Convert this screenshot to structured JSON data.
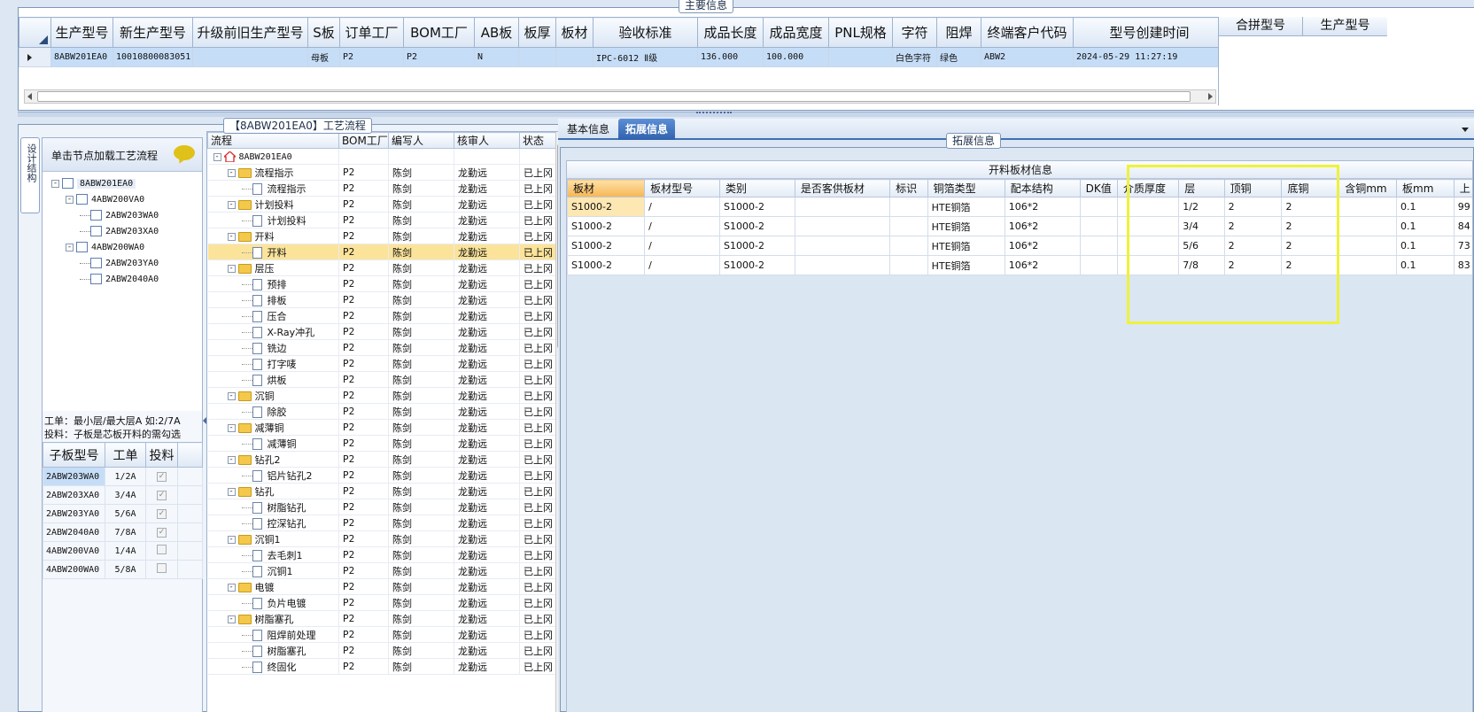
{
  "main_info": {
    "title": "主要信息",
    "columns": [
      "生产型号",
      "新生产型号",
      "升级前旧生产型号",
      "S板",
      "订单工厂",
      "BOM工厂",
      "AB板",
      "板厚",
      "板材",
      "验收标准",
      "成品长度",
      "成品宽度",
      "PNL规格",
      "字符",
      "阻焊",
      "终端客户代码",
      "型号创建时间"
    ],
    "rows": [
      [
        "8ABW201EA0",
        "10010800083051",
        "",
        "母板",
        "P2",
        "P2",
        "N",
        "",
        "",
        "IPC-6012 Ⅱ级",
        "136.000",
        "100.000",
        "",
        "白色字符",
        "绿色",
        "ABW2",
        "2024-05-29 11:27:19"
      ]
    ],
    "side_columns": [
      "合拼型号",
      "生产型号"
    ]
  },
  "process_panel": {
    "title": "【8ABW201EA0】工艺流程",
    "vertical_tab": "设计结构",
    "hint": "单击节点加载工艺流程",
    "tree": [
      {
        "label": "8ABW201EA0",
        "level": 0,
        "expander": "-"
      },
      {
        "label": "4ABW200VA0",
        "level": 1,
        "expander": "-"
      },
      {
        "label": "2ABW203WA0",
        "level": 2,
        "expander": ""
      },
      {
        "label": "2ABW203XA0",
        "level": 2,
        "expander": ""
      },
      {
        "label": "4ABW200WA0",
        "level": 1,
        "expander": "-"
      },
      {
        "label": "2ABW203YA0",
        "level": 2,
        "expander": ""
      },
      {
        "label": "2ABW2040A0",
        "level": 2,
        "expander": ""
      }
    ],
    "notes": [
      "工单：最小层/最大层A 如:2/7A",
      "投料：子板是芯板开料的需勾选"
    ],
    "sub_columns": [
      "子板型号",
      "工单",
      "投料"
    ],
    "sub_rows": [
      {
        "model": "2ABW203WA0",
        "order": "1/2A",
        "checked": true
      },
      {
        "model": "2ABW203XA0",
        "order": "3/4A",
        "checked": true
      },
      {
        "model": "2ABW203YA0",
        "order": "5/6A",
        "checked": true
      },
      {
        "model": "2ABW2040A0",
        "order": "7/8A",
        "checked": true
      },
      {
        "model": "4ABW200VA0",
        "order": "1/4A",
        "checked": false
      },
      {
        "model": "4ABW200WA0",
        "order": "5/8A",
        "checked": false
      }
    ],
    "check_glyph": "✓",
    "flow_columns": [
      "流程",
      "BOM工厂",
      "编写人",
      "核审人",
      "状态"
    ],
    "flow_rows": [
      {
        "label": "8ABW201EA0",
        "type": "root",
        "level": 0,
        "bom": "",
        "writer": "",
        "reviewer": "",
        "status": ""
      },
      {
        "label": "流程指示",
        "type": "folder",
        "level": 1,
        "bom": "P2",
        "writer": "陈剑",
        "reviewer": "龙勤远",
        "status": "已上冈"
      },
      {
        "label": "流程指示",
        "type": "doc",
        "level": 2,
        "bom": "P2",
        "writer": "陈剑",
        "reviewer": "龙勤远",
        "status": "已上冈"
      },
      {
        "label": "计划投料",
        "type": "folder",
        "level": 1,
        "bom": "P2",
        "writer": "陈剑",
        "reviewer": "龙勤远",
        "status": "已上冈"
      },
      {
        "label": "计划投料",
        "type": "doc",
        "level": 2,
        "bom": "P2",
        "writer": "陈剑",
        "reviewer": "龙勤远",
        "status": "已上冈"
      },
      {
        "label": "开料",
        "type": "folder",
        "level": 1,
        "bom": "P2",
        "writer": "陈剑",
        "reviewer": "龙勤远",
        "status": "已上冈"
      },
      {
        "label": "开料",
        "type": "doc",
        "level": 2,
        "bom": "P2",
        "writer": "陈剑",
        "reviewer": "龙勤远",
        "status": "已上冈",
        "selected": true
      },
      {
        "label": "层压",
        "type": "folder",
        "level": 1,
        "bom": "P2",
        "writer": "陈剑",
        "reviewer": "龙勤远",
        "status": "已上冈"
      },
      {
        "label": "预排",
        "type": "doc",
        "level": 2,
        "bom": "P2",
        "writer": "陈剑",
        "reviewer": "龙勤远",
        "status": "已上冈"
      },
      {
        "label": "排板",
        "type": "doc",
        "level": 2,
        "bom": "P2",
        "writer": "陈剑",
        "reviewer": "龙勤远",
        "status": "已上冈"
      },
      {
        "label": "压合",
        "type": "doc",
        "level": 2,
        "bom": "P2",
        "writer": "陈剑",
        "reviewer": "龙勤远",
        "status": "已上冈"
      },
      {
        "label": "X-Ray冲孔",
        "type": "doc",
        "level": 2,
        "bom": "P2",
        "writer": "陈剑",
        "reviewer": "龙勤远",
        "status": "已上冈"
      },
      {
        "label": "铣边",
        "type": "doc",
        "level": 2,
        "bom": "P2",
        "writer": "陈剑",
        "reviewer": "龙勤远",
        "status": "已上冈"
      },
      {
        "label": "打字唛",
        "type": "doc",
        "level": 2,
        "bom": "P2",
        "writer": "陈剑",
        "reviewer": "龙勤远",
        "status": "已上冈"
      },
      {
        "label": "烘板",
        "type": "doc",
        "level": 2,
        "bom": "P2",
        "writer": "陈剑",
        "reviewer": "龙勤远",
        "status": "已上冈"
      },
      {
        "label": "沉铜",
        "type": "folder",
        "level": 1,
        "bom": "P2",
        "writer": "陈剑",
        "reviewer": "龙勤远",
        "status": "已上冈"
      },
      {
        "label": "除胶",
        "type": "doc",
        "level": 2,
        "bom": "P2",
        "writer": "陈剑",
        "reviewer": "龙勤远",
        "status": "已上冈"
      },
      {
        "label": "减薄铜",
        "type": "folder",
        "level": 1,
        "bom": "P2",
        "writer": "陈剑",
        "reviewer": "龙勤远",
        "status": "已上冈"
      },
      {
        "label": "减薄铜",
        "type": "doc",
        "level": 2,
        "bom": "P2",
        "writer": "陈剑",
        "reviewer": "龙勤远",
        "status": "已上冈"
      },
      {
        "label": "钻孔2",
        "type": "folder",
        "level": 1,
        "bom": "P2",
        "writer": "陈剑",
        "reviewer": "龙勤远",
        "status": "已上冈"
      },
      {
        "label": "铝片钻孔2",
        "type": "doc",
        "level": 2,
        "bom": "P2",
        "writer": "陈剑",
        "reviewer": "龙勤远",
        "status": "已上冈"
      },
      {
        "label": "钻孔",
        "type": "folder",
        "level": 1,
        "bom": "P2",
        "writer": "陈剑",
        "reviewer": "龙勤远",
        "status": "已上冈"
      },
      {
        "label": "树脂钻孔",
        "type": "doc",
        "level": 2,
        "bom": "P2",
        "writer": "陈剑",
        "reviewer": "龙勤远",
        "status": "已上冈"
      },
      {
        "label": "控深钻孔",
        "type": "doc",
        "level": 2,
        "bom": "P2",
        "writer": "陈剑",
        "reviewer": "龙勤远",
        "status": "已上冈"
      },
      {
        "label": "沉铜1",
        "type": "folder",
        "level": 1,
        "bom": "P2",
        "writer": "陈剑",
        "reviewer": "龙勤远",
        "status": "已上冈"
      },
      {
        "label": "去毛刺1",
        "type": "doc",
        "level": 2,
        "bom": "P2",
        "writer": "陈剑",
        "reviewer": "龙勤远",
        "status": "已上冈"
      },
      {
        "label": "沉铜1",
        "type": "doc",
        "level": 2,
        "bom": "P2",
        "writer": "陈剑",
        "reviewer": "龙勤远",
        "status": "已上冈"
      },
      {
        "label": "电镀",
        "type": "folder",
        "level": 1,
        "bom": "P2",
        "writer": "陈剑",
        "reviewer": "龙勤远",
        "status": "已上冈"
      },
      {
        "label": "负片电镀",
        "type": "doc",
        "level": 2,
        "bom": "P2",
        "writer": "陈剑",
        "reviewer": "龙勤远",
        "status": "已上冈"
      },
      {
        "label": "树脂塞孔",
        "type": "folder",
        "level": 1,
        "bom": "P2",
        "writer": "陈剑",
        "reviewer": "龙勤远",
        "status": "已上冈"
      },
      {
        "label": "阻焊前处理",
        "type": "doc",
        "level": 2,
        "bom": "P2",
        "writer": "陈剑",
        "reviewer": "龙勤远",
        "status": "已上冈"
      },
      {
        "label": "树脂塞孔",
        "type": "doc",
        "level": 2,
        "bom": "P2",
        "writer": "陈剑",
        "reviewer": "龙勤远",
        "status": "已上冈"
      },
      {
        "label": "终固化",
        "type": "doc",
        "level": 2,
        "bom": "P2",
        "writer": "陈剑",
        "reviewer": "龙勤远",
        "status": "已上冈"
      }
    ]
  },
  "right_panel": {
    "tabs": [
      "基本信息",
      "拓展信息"
    ],
    "active_tab": 1,
    "group_title": "拓展信息",
    "table_title": "开料板材信息",
    "columns": [
      "板材",
      "板材型号",
      "类别",
      "是否客供板材",
      "标识",
      "铜箔类型",
      "配本结构",
      "DK值",
      "介质厚度",
      "层",
      "顶铜",
      "底铜",
      "含铜mm",
      "板mm",
      "上"
    ],
    "rows": [
      [
        "S1000-2",
        "/",
        "S1000-2",
        "",
        "",
        "HTE铜箔",
        "106*2",
        "",
        "",
        "1/2",
        "2",
        "2",
        "",
        "0.1",
        "99"
      ],
      [
        "S1000-2",
        "/",
        "S1000-2",
        "",
        "",
        "HTE铜箔",
        "106*2",
        "",
        "",
        "3/4",
        "2",
        "2",
        "",
        "0.1",
        "84"
      ],
      [
        "S1000-2",
        "/",
        "S1000-2",
        "",
        "",
        "HTE铜箔",
        "106*2",
        "",
        "",
        "5/6",
        "2",
        "2",
        "",
        "0.1",
        "73"
      ],
      [
        "S1000-2",
        "/",
        "S1000-2",
        "",
        "",
        "HTE铜箔",
        "106*2",
        "",
        "",
        "7/8",
        "2",
        "2",
        "",
        "0.1",
        "83"
      ]
    ],
    "highlight_color": "#eef23a"
  }
}
